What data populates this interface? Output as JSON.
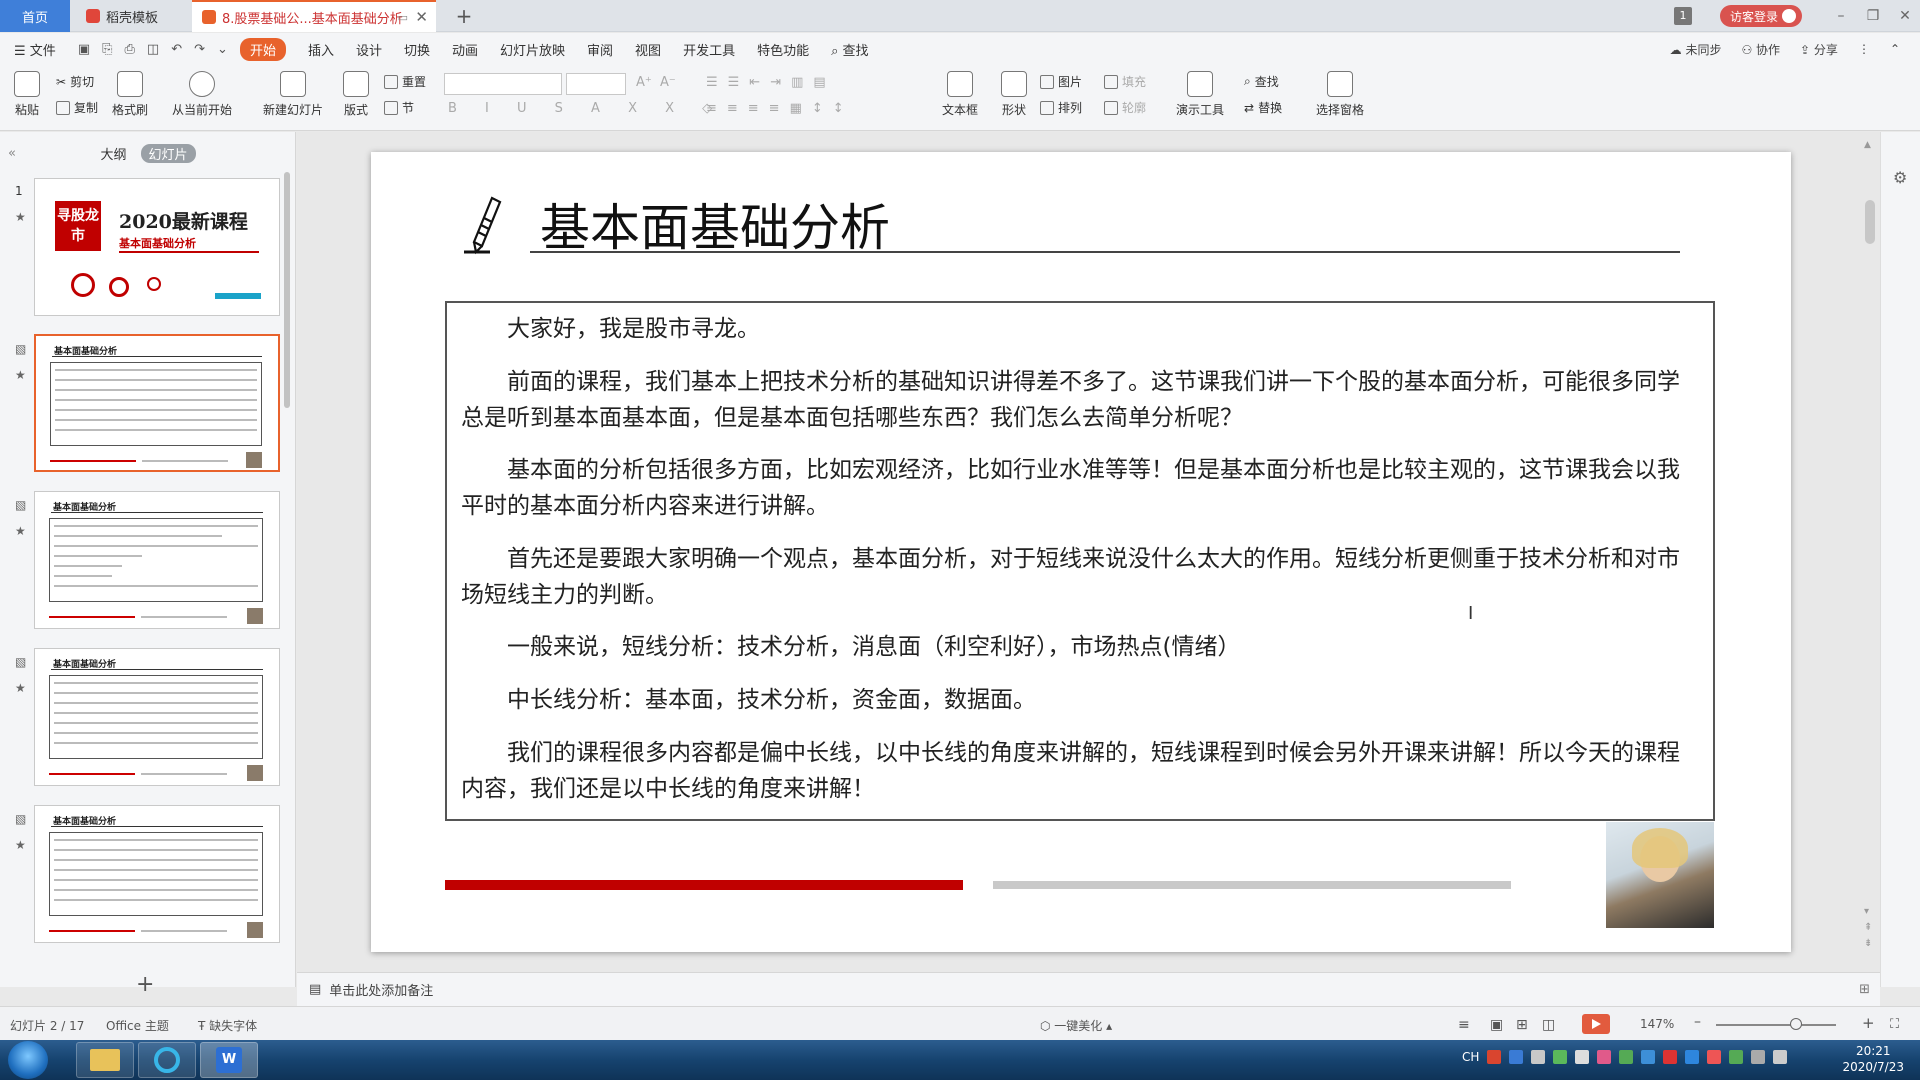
{
  "tabs": {
    "home": "首页",
    "template": "稻壳模板",
    "document": "8.股票基础公...基本面基础分析",
    "login": "访客登录",
    "window_badge": "1"
  },
  "menu": {
    "file": "文件",
    "items": [
      "开始",
      "插入",
      "设计",
      "切换",
      "动画",
      "幻灯片放映",
      "审阅",
      "视图",
      "开发工具",
      "特色功能"
    ],
    "search": "查找",
    "right": {
      "sync": "未同步",
      "collab": "协作",
      "share": "分享"
    }
  },
  "ribbon": {
    "paste": "粘贴",
    "cut": "剪切",
    "copy": "复制",
    "format_painter": "格式刷",
    "play_from_current": "从当前开始",
    "new_slide": "新建幻灯片",
    "layout": "版式",
    "reset": "重置",
    "section": "节",
    "text_box": "文本框",
    "shape": "形状",
    "picture": "图片",
    "arrange": "排列",
    "fill": "填充",
    "outline": "轮廓",
    "presentation_tools": "演示工具",
    "find": "查找",
    "replace": "替换",
    "selection_pane": "选择窗格"
  },
  "left_panel": {
    "outline_tab": "大纲",
    "slides_tab": "幻灯片",
    "thumbs": [
      {
        "num": "1",
        "title": "2020最新课程",
        "subtitle": "基本面基础分析",
        "logo": "寻股龙市"
      },
      {
        "num": "",
        "title": "基本面基础分析"
      },
      {
        "num": "",
        "title": "基本面基础分析"
      },
      {
        "num": "",
        "title": "基本面基础分析"
      },
      {
        "num": "",
        "title": "基本面基础分析"
      }
    ]
  },
  "slide": {
    "title": "基本面基础分析",
    "paragraphs": [
      "大家好，我是股市寻龙。",
      "前面的课程，我们基本上把技术分析的基础知识讲得差不多了。这节课我们讲一下个股的基本面分析，可能很多同学总是听到基本面基本面，但是基本面包括哪些东西？我们怎么去简单分析呢？",
      "基本面的分析包括很多方面，比如宏观经济，比如行业水准等等！但是基本面分析也是比较主观的，这节课我会以我平时的基本面分析内容来进行讲解。",
      "首先还是要跟大家明确一个观点，基本面分析，对于短线来说没什么太大的作用。短线分析更侧重于技术分析和对市场短线主力的判断。",
      "一般来说，短线分析：技术分析，消息面（利空利好），市场热点(情绪）",
      "中长线分析：基本面，技术分析，资金面，数据面。",
      "我们的课程很多内容都是偏中长线，以中长线的角度来讲解的，短线课程到时候会另外开课来讲解！所以今天的课程内容，我们还是以中长线的角度来讲解！"
    ]
  },
  "notes_placeholder": "单击此处添加备注",
  "status": {
    "slide_counter": "幻灯片 2 / 17",
    "theme": "Office 主题",
    "missing_font": "缺失字体",
    "beautify": "一键美化",
    "zoom": "147%"
  },
  "taskbar": {
    "time": "20:21",
    "date": "2020/7/23",
    "ime": "CH"
  },
  "colors": {
    "accent": "#e8622c",
    "slide_red_bar": "#c00000",
    "taskbar": "#16436f"
  }
}
